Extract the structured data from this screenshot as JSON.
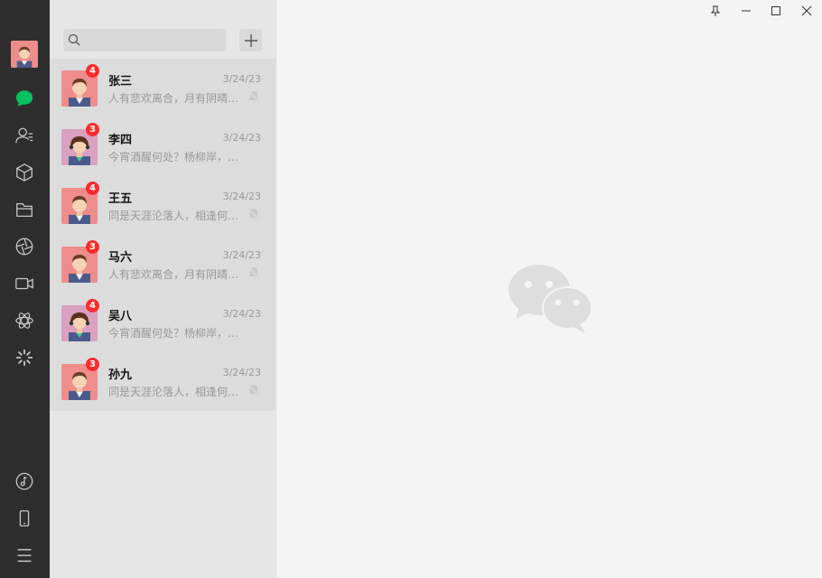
{
  "app": {
    "name": "WeChat"
  },
  "sidebar": {
    "user_avatar": "user-avatar",
    "nav_icons": [
      "chat-icon",
      "contacts-icon",
      "favorites-icon",
      "files-icon",
      "moments-icon",
      "video-channel-icon",
      "discover-icon",
      "mini-program-icon"
    ],
    "bottom_icons": [
      "music-icon",
      "phone-icon",
      "menu-icon"
    ],
    "active_color": "#07c160"
  },
  "search": {
    "value": "",
    "placeholder": ""
  },
  "chats": [
    {
      "name": "张三",
      "date": "3/24/23",
      "preview": "人有悲欢离合，月有阴晴…",
      "unread": "4",
      "avatar": "male",
      "muted": true
    },
    {
      "name": "李四",
      "date": "3/24/23",
      "preview": "今宵酒醒何处？杨柳岸，…",
      "unread": "3",
      "avatar": "female",
      "muted": false
    },
    {
      "name": "王五",
      "date": "3/24/23",
      "preview": "同是天涯沦落人，相逢何…",
      "unread": "4",
      "avatar": "male",
      "muted": true
    },
    {
      "name": "马六",
      "date": "3/24/23",
      "preview": "人有悲欢离合，月有阴晴…",
      "unread": "3",
      "avatar": "male",
      "muted": true
    },
    {
      "name": "吴八",
      "date": "3/24/23",
      "preview": "今宵酒醒何处？杨柳岸，…",
      "unread": "4",
      "avatar": "female",
      "muted": false
    },
    {
      "name": "孙九",
      "date": "3/24/23",
      "preview": "同是天涯沦落人，相逢何…",
      "unread": "3",
      "avatar": "male",
      "muted": true
    }
  ],
  "colors": {
    "badge": "#fa2c2c",
    "sidebar": "#2e2e2e",
    "list_bg": "#e6e6e6",
    "item_bg": "#dcdcdc"
  }
}
